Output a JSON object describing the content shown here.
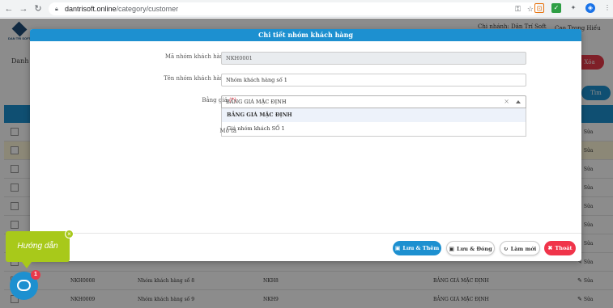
{
  "browser": {
    "url_host": "dantrisoft.online",
    "url_path": "/category/customer"
  },
  "app": {
    "logo_text": "DAN TRI SOFT",
    "user_label": "Chi nhánh: Dân Trí Soft",
    "user_name": "Cao Trọng Hiếu",
    "page_title": "Danh m",
    "delete_button": "Xóa",
    "search_button": "Tìm",
    "rows": [
      {
        "code": "",
        "name": "",
        "group": "",
        "price": ""
      },
      {
        "code": "",
        "name": "",
        "group": "",
        "price": ""
      },
      {
        "code": "",
        "name": "",
        "group": "",
        "price": ""
      },
      {
        "code": "",
        "name": "",
        "group": "",
        "price": ""
      },
      {
        "code": "",
        "name": "",
        "group": "",
        "price": ""
      },
      {
        "code": "",
        "name": "",
        "group": "",
        "price": ""
      },
      {
        "code": "",
        "name": "",
        "group": "",
        "price": ""
      },
      {
        "code": "",
        "name": "",
        "group": "",
        "price": ""
      },
      {
        "code": "NKH0008",
        "name": "Nhóm khách hàng số 8",
        "group": "NKH8",
        "price": "BẢNG GIÁ MẶC ĐỊNH"
      },
      {
        "code": "NKH0009",
        "name": "Nhóm khách hàng số 9",
        "group": "NKH9",
        "price": "BẢNG GIÁ MẶC ĐỊNH"
      }
    ],
    "edit_label": "Sửa"
  },
  "modal": {
    "title": "Chi tiết nhóm khách hàng",
    "fields": {
      "code_label": "Mã nhóm khách hàng",
      "code_value": "NKH0001",
      "name_label": "Tên nhóm khách hàng",
      "name_value": "Nhóm khách hàng số 1",
      "price_label": "Bảng giá",
      "price_value": "BẢNG GIÁ MẶC ĐỊNH",
      "desc_label": "Mô tả",
      "required_mark": "(*)"
    },
    "price_options": [
      "BẢNG GIÁ MẶC ĐỊNH",
      "Giá nhóm khách SỐ 1"
    ],
    "buttons": {
      "save_add": "Lưu & Thêm",
      "save_close": "Lưu & Đóng",
      "refresh": "Làm mới",
      "exit": "Thoát"
    }
  },
  "help_widget": {
    "label": "Hướng dẫn",
    "badge": "1"
  },
  "colors": {
    "primary": "#1d90d0",
    "danger": "#f0344a",
    "help": "#a8c91a"
  }
}
